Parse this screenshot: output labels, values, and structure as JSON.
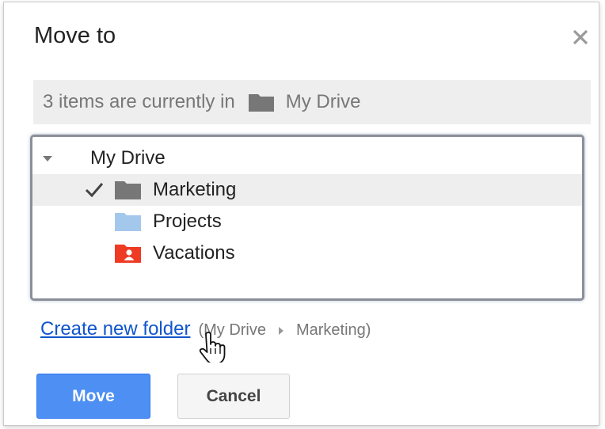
{
  "dialog": {
    "title": "Move to",
    "close_icon": "close-icon"
  },
  "info": {
    "prefix": "3 items are currently in",
    "location": "My Drive",
    "icon": "folder-icon"
  },
  "tree": {
    "root": {
      "label": "My Drive",
      "expanded": true,
      "icon": "triangle-down-icon"
    },
    "folders": [
      {
        "label": "Marketing",
        "selected": true,
        "icon": "folder-icon",
        "color": "#777777"
      },
      {
        "label": "Projects",
        "selected": false,
        "icon": "folder-icon",
        "color": "#a4c8ec"
      },
      {
        "label": "Vacations",
        "selected": false,
        "icon": "shared-folder-icon",
        "color": "#ef3a24"
      }
    ]
  },
  "create": {
    "link_label": "Create new folder",
    "path_open": "(My Drive",
    "path_close": "Marketing)"
  },
  "buttons": {
    "move": "Move",
    "cancel": "Cancel"
  },
  "colors": {
    "primary": "#4d8ff2",
    "link": "#1155cc",
    "selected_row": "#eeeeee",
    "info_bar": "#eeeeee"
  }
}
